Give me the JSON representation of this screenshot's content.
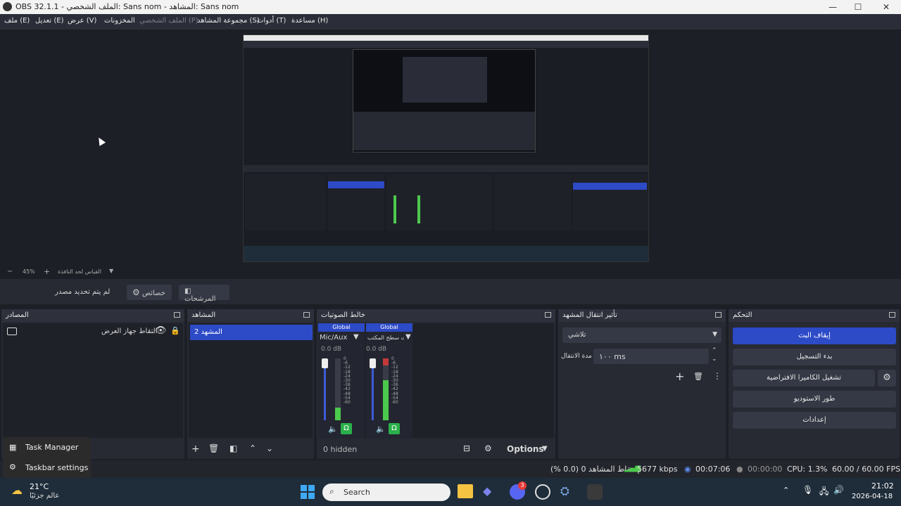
{
  "window": {
    "title": "OBS 32.1.1 - الملف الشخصي: Sans nom - المشاهد: Sans nom"
  },
  "menu": {
    "file": "ملف (E)",
    "edit": "تعديل (E)",
    "view": "عرض (V)",
    "docks": "المخزونات",
    "profile": "الملف الشخصي (P)",
    "scene_collection": "مجموعة المشاهد (S)",
    "tools": "أدوات (T)",
    "help": "مساعدة (H)"
  },
  "zoom": {
    "minus": "−",
    "value": "45%",
    "plus": "+",
    "mode": "القياس لحد النافذة"
  },
  "context": {
    "no_source": "لم يتم تحديد مصدر",
    "properties": "خصائص",
    "filters": "المرشحات"
  },
  "docks": {
    "sources": {
      "title": "المصادر",
      "items": [
        {
          "label": "التقاط جهاز العرض"
        }
      ]
    },
    "scenes": {
      "title": "المشاهد",
      "items": [
        {
          "label": "المشهد 2"
        }
      ]
    },
    "mixer": {
      "title": "خالط الصوتيات",
      "channels": [
        {
          "badge": "Global",
          "name": "Mic/Aux",
          "db": "0.0 dB",
          "level": 0.2
        },
        {
          "badge": "Global",
          "name": "صوت سطح المكتب",
          "db": "0.0 dB",
          "level": 0.65
        }
      ],
      "scale": [
        "0",
        "-6",
        "-12",
        "-18",
        "-24",
        "-30",
        "-36",
        "-42",
        "-48",
        "-54",
        "-60"
      ],
      "hidden": "0 hidden",
      "options": "Options"
    },
    "transitions": {
      "title": "تأثير انتقال المشهد",
      "selected": "تلاشي",
      "duration_label": "مدة الانتقال",
      "duration_value": "١٠٠ ms"
    },
    "controls": {
      "title": "التحكم",
      "stop_stream": "إيقاف البث",
      "start_record": "بدء التسجيل",
      "virtual_camera": "تشغيل الكاميرا الافتراضية",
      "studio_mode": "طور الاستوديو",
      "settings": "إعدادات"
    }
  },
  "status": {
    "dropped": "إسقاط المشاهد 0 (0.0 %)",
    "bitrate": "5677 kbps",
    "stream_time": "00:07:06",
    "rec_time": "00:00:00",
    "cpu": "CPU: 1.3%",
    "fps": "60.00 / 60.00 FPS"
  },
  "taskbar": {
    "weather_temp": "21°C",
    "weather_desc": "عالم جزئيًا",
    "search_placeholder": "Search",
    "clock_time": "21:02",
    "clock_date": "2026-04-18",
    "popup_task_manager": "Task Manager",
    "popup_taskbar_settings": "Taskbar settings",
    "badge_count": "3"
  },
  "colors": {
    "accent": "#2d4ac7",
    "meter_green": "#4cc94c",
    "meter_yellow": "#d9c63a",
    "meter_red": "#c43a3a"
  }
}
